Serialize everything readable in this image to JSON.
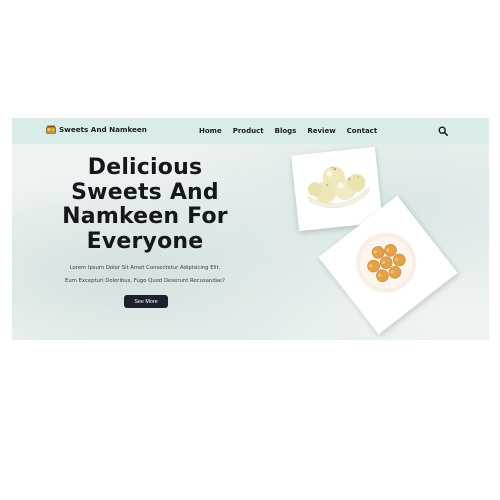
{
  "brand": {
    "name": "Sweets And Namkeen",
    "logo_icon": "sweets-box-icon"
  },
  "nav": {
    "links": [
      "Home",
      "Product",
      "Blogs",
      "Review",
      "Contact"
    ],
    "search_icon": "search-icon"
  },
  "hero": {
    "title_lines": [
      "Delicious",
      "Sweets And",
      "Namkeen For",
      "Everyone"
    ],
    "description_lines": [
      "Lorem Ipsum Dolor Sit Amet Consectetur Adipisicing Elit.",
      "Eum Excepturi Doloribus, Fugo Quod Deserunt Recusandae?"
    ],
    "cta_label": "See More"
  },
  "images": [
    {
      "name": "rasgulla-photo",
      "alt": "Rasgulla bowl"
    },
    {
      "name": "laddoo-photo",
      "alt": "Laddoo plate"
    }
  ],
  "colors": {
    "navbar": "#d9ece9",
    "hero_background": "#eef3f2",
    "button": "#1d1f2c",
    "text": "#16161e"
  }
}
